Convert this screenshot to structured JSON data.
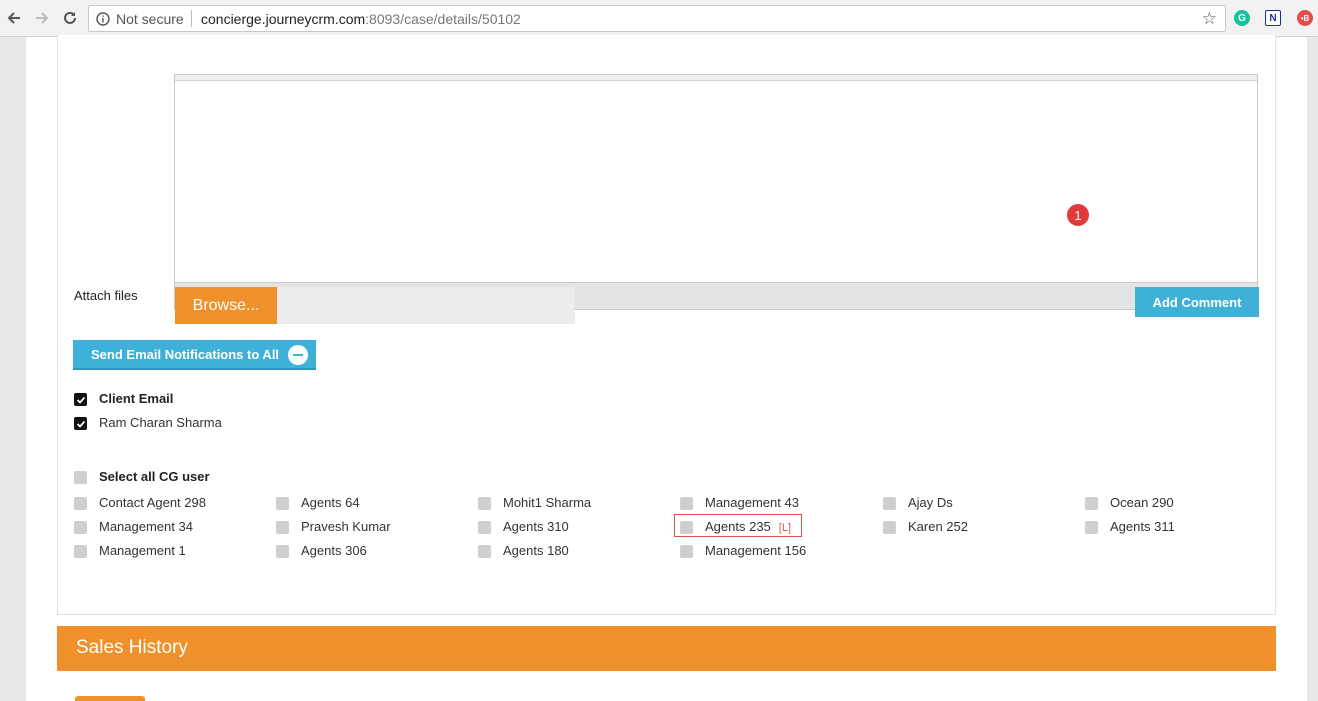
{
  "browser": {
    "security_label": "Not secure",
    "url_host": "concierge.journeycrm.com",
    "url_rest": ":8093/case/details/50102"
  },
  "editor": {
    "badge_count": "1"
  },
  "attach": {
    "label": "Attach files",
    "browse_label": "Browse...",
    "add_comment_label": "Add Comment"
  },
  "notify": {
    "button_label": "Send Email Notifications to All"
  },
  "recipients": [
    {
      "label": "Client Email",
      "checked": true,
      "bold": true
    },
    {
      "label": "Ram Charan Sharma",
      "checked": true,
      "bold": false
    }
  ],
  "cg_users": {
    "select_all_label": "Select all CG user",
    "columns": [
      [
        "Contact Agent 298",
        "Management 34",
        "Management 1"
      ],
      [
        "Agents 64",
        "Pravesh Kumar",
        "Agents 306"
      ],
      [
        "Mohit1 Sharma",
        "Agents 310",
        "Agents 180"
      ],
      [
        "Management 43",
        "Agents 235",
        "Management 156"
      ],
      [
        "Ajay Ds",
        "Karen 252"
      ],
      [
        "Ocean 290",
        "Agents 311"
      ]
    ],
    "highlighted_tag": "[L]"
  },
  "sales": {
    "title": "Sales History"
  },
  "colors": {
    "accent_orange": "#f0902a",
    "accent_blue": "#3fb1d9",
    "badge_red": "#e03a3a"
  }
}
